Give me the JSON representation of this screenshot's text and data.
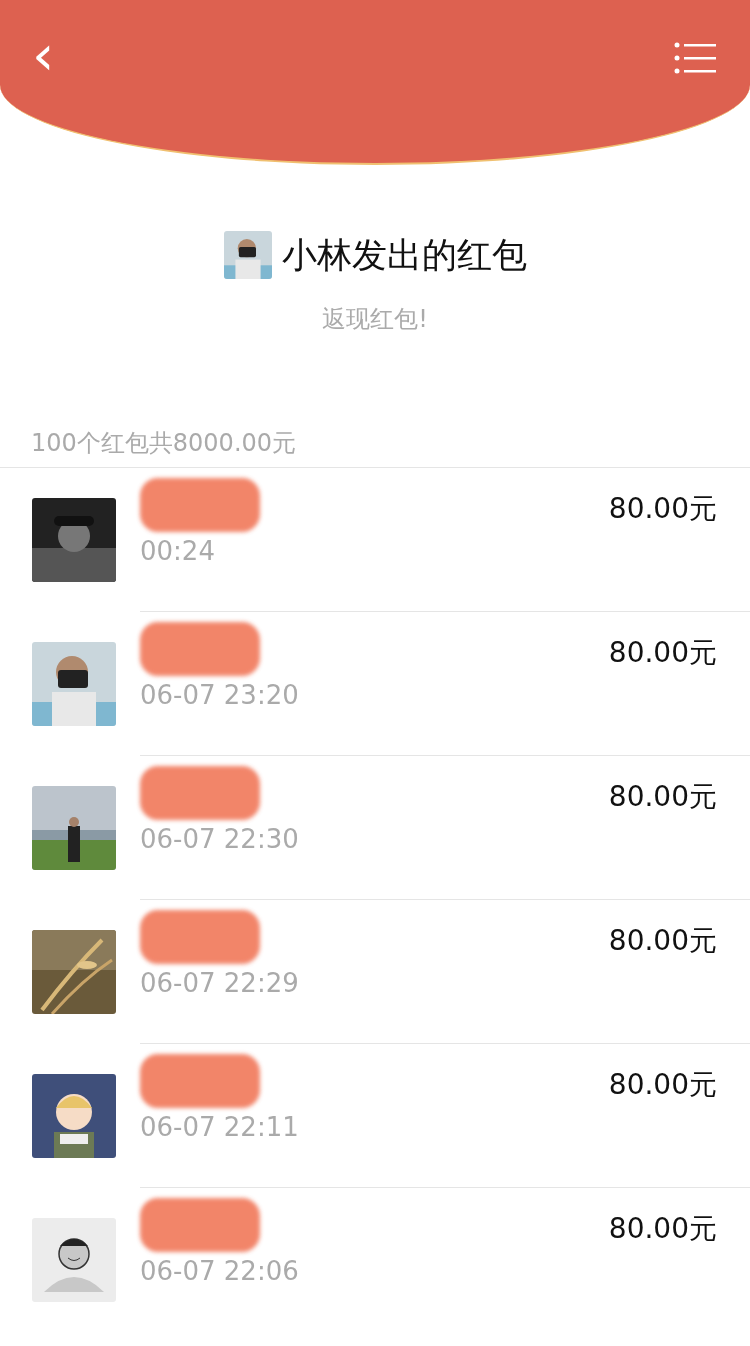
{
  "header": {
    "back_icon": "‹"
  },
  "sender": {
    "title": "小林发出的红包",
    "message": "返现红包!"
  },
  "summary": "100个红包共8000.00元",
  "rows": [
    {
      "kind": "picture",
      "name_redacted": true,
      "time": "00:24",
      "amount": "80.00元"
    },
    {
      "kind": "picture",
      "name_redacted": true,
      "time": "06-07 23:20",
      "amount": "80.00元"
    },
    {
      "kind": "picture",
      "name_redacted": true,
      "time": "06-07 22:30",
      "amount": "80.00元"
    },
    {
      "kind": "picture",
      "name_redacted": true,
      "time": "06-07 22:29",
      "amount": "80.00元"
    },
    {
      "kind": "picture",
      "name_redacted": true,
      "time": "06-07 22:11",
      "amount": "80.00元"
    },
    {
      "kind": "default",
      "name_redacted": true,
      "time": "06-07 22:06",
      "amount": "80.00元"
    }
  ]
}
